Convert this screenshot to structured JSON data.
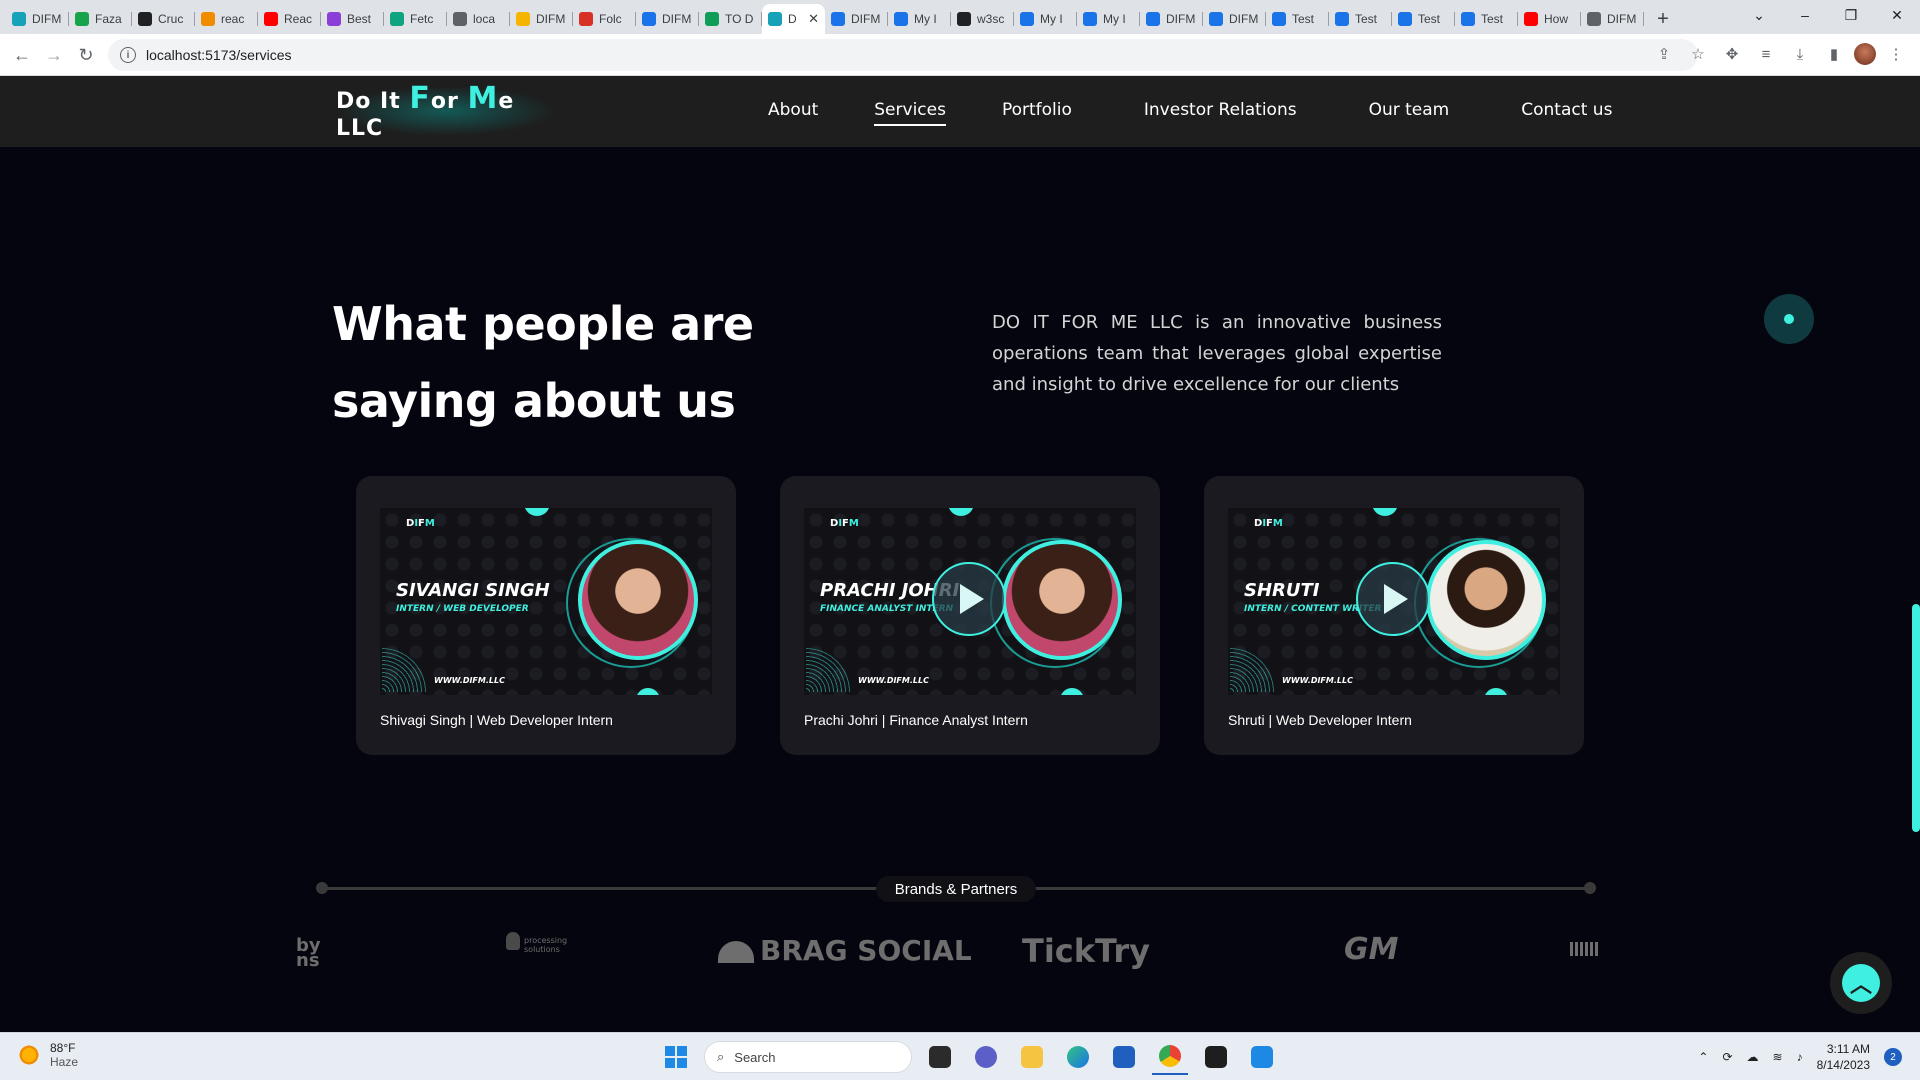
{
  "browser": {
    "tabs": [
      {
        "label": "DIFM",
        "color": "#17a2b8"
      },
      {
        "label": "Faza",
        "color": "#16a34a"
      },
      {
        "label": "Cruc",
        "color": "#202124"
      },
      {
        "label": "reac",
        "color": "#f08c00"
      },
      {
        "label": "Reac",
        "color": "#ff0000"
      },
      {
        "label": "Best",
        "color": "#8b3fd9"
      },
      {
        "label": "Fetc",
        "color": "#10a37f"
      },
      {
        "label": "loca",
        "color": "#5f6368"
      },
      {
        "label": "DIFM",
        "color": "#f5b400"
      },
      {
        "label": "Folc",
        "color": "#d93025"
      },
      {
        "label": "DIFM",
        "color": "#1a73e8"
      },
      {
        "label": "TO D",
        "color": "#0f9d58"
      },
      {
        "label": "D",
        "color": "#17a2b8"
      },
      {
        "label": "DIFM",
        "color": "#1a73e8"
      },
      {
        "label": "My I",
        "color": "#1a73e8"
      },
      {
        "label": "w3sc",
        "color": "#202124"
      },
      {
        "label": "My I",
        "color": "#1a73e8"
      },
      {
        "label": "My I",
        "color": "#1a73e8"
      },
      {
        "label": "DIFM",
        "color": "#1a73e8"
      },
      {
        "label": "DIFM",
        "color": "#1a73e8"
      },
      {
        "label": "Test",
        "color": "#1a73e8"
      },
      {
        "label": "Test",
        "color": "#1a73e8"
      },
      {
        "label": "Test",
        "color": "#1a73e8"
      },
      {
        "label": "Test",
        "color": "#1a73e8"
      },
      {
        "label": "How",
        "color": "#ff0000"
      },
      {
        "label": "DIFM",
        "color": "#5f6368"
      }
    ],
    "active_tab_index": 12,
    "url": "localhost:5173/services"
  },
  "site": {
    "logo_parts": [
      "Do It ",
      "F",
      "or ",
      "M",
      "e LLC"
    ],
    "nav": [
      {
        "label": "About",
        "active": false
      },
      {
        "label": "Services",
        "active": true
      },
      {
        "label": "Portfolio",
        "active": false
      },
      {
        "label": "Investor Relations",
        "active": false
      },
      {
        "label": "Our team",
        "active": false
      },
      {
        "label": "Contact us",
        "active": false
      }
    ],
    "heading": "What people are saying about us",
    "intro": "DO IT FOR ME LLC is an innovative business operations team that leverages global expertise and insight to drive excellence for our clients",
    "testimonials": [
      {
        "thumb_name": "SIVANGI SINGH",
        "thumb_role": "INTERN / WEB DEVELOPER",
        "url": "WWW.DIFM.LLC",
        "caption": "Shivagi Singh | Web Developer Intern",
        "play": false,
        "avatar_style": "dark"
      },
      {
        "thumb_name": "PRACHI JOHRI",
        "thumb_role": "FINANCE ANALYST INTERN",
        "url": "WWW.DIFM.LLC",
        "caption": "Prachi Johri | Finance Analyst Intern",
        "play": true,
        "avatar_style": "dark"
      },
      {
        "thumb_name": "SHRUTI",
        "thumb_role": "INTERN / CONTENT WRITER",
        "url": "WWW.DIFM.LLC",
        "caption": "Shruti | Web Developer Intern",
        "play": true,
        "avatar_style": "light"
      }
    ],
    "brands_label": "Brands & Partners",
    "brands": [
      "by ns",
      "processing solutions",
      "BRAG SOCIAL",
      "TickTry",
      "GM"
    ]
  },
  "taskbar": {
    "weather_temp": "88°F",
    "weather_desc": "Haze",
    "search_placeholder": "Search",
    "time": "3:11 AM",
    "date": "8/14/2023",
    "notifications": "2"
  },
  "colors": {
    "accent": "#3ff0e0",
    "page_bg": "#05050f",
    "nav_bg": "#1e1e1e",
    "card_bg": "#1a1a20"
  }
}
